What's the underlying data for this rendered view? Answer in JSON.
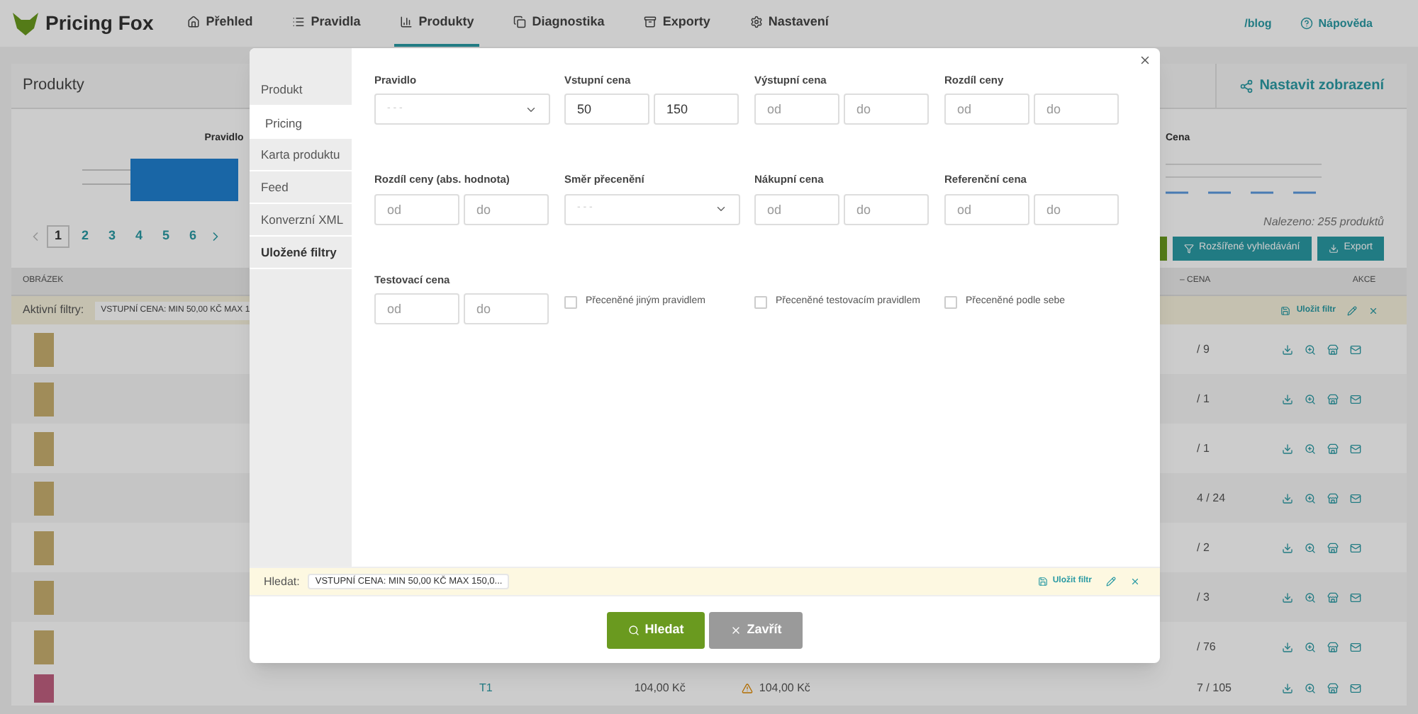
{
  "nav": {
    "brand": "Pricing Fox",
    "items": [
      {
        "label": "Přehled",
        "selected": false
      },
      {
        "label": "Pravidla",
        "selected": false
      },
      {
        "label": "Produkty",
        "selected": true
      },
      {
        "label": "Diagnostika",
        "selected": false
      },
      {
        "label": "Exporty",
        "selected": false
      },
      {
        "label": "Nastavení",
        "selected": false
      }
    ],
    "links": [
      "/blog",
      "Nápověda"
    ]
  },
  "page": {
    "title": "Produkty",
    "settings_button": "Nastavit zobrazení",
    "chart_left_title": "Pravidlo",
    "chart_right_title": "Cena",
    "pages": [
      {
        "label": "1",
        "selected": true
      },
      {
        "label": "2",
        "selected": false
      },
      {
        "label": "3",
        "selected": false
      },
      {
        "label": "4",
        "selected": false
      },
      {
        "label": "5",
        "selected": false
      },
      {
        "label": "6",
        "selected": false
      }
    ],
    "found": "Nalezeno: 255 produktů",
    "buttons": [
      "Rozšířené vyhledávání",
      "Export"
    ],
    "columns": [
      "OBRÁZEK",
      "– CENA",
      "AKCE"
    ],
    "active_filters": {
      "label": "Aktivní filtry:",
      "chip": "VSTUPNÍ CENA: MIN 50,00 KČ MAX 1",
      "save": "Uložit filtr"
    },
    "rows": [
      {
        "count": "/ 9"
      },
      {
        "count": "/ 1"
      },
      {
        "count": "/ 1"
      },
      {
        "count": "4 / 24"
      },
      {
        "count": "/ 2"
      },
      {
        "count": "/ 3"
      },
      {
        "count": "/ 76"
      }
    ],
    "last_row": {
      "rule": "T1",
      "price": "104,00 Kč",
      "new_price": "104,00 Kč",
      "count": "7 / 105"
    }
  },
  "modal": {
    "tabs": [
      {
        "label": "Produkt",
        "selected": false,
        "bold": false
      },
      {
        "label": "Pricing",
        "selected": true,
        "bold": false
      },
      {
        "label": "Karta produktu",
        "selected": false,
        "bold": false
      },
      {
        "label": "Feed",
        "selected": false,
        "bold": false
      },
      {
        "label": "Konverzní XML",
        "selected": false,
        "bold": false
      },
      {
        "label": "Uložené filtry",
        "selected": false,
        "bold": true
      }
    ],
    "fields": [
      {
        "kind": "select",
        "label": "Pravidlo",
        "placeholder": "- - -"
      },
      {
        "kind": "range",
        "label": "Vstupní cena",
        "from": {
          "value": "50"
        },
        "to": {
          "value": "150"
        }
      },
      {
        "kind": "range",
        "label": "Výstupní cena",
        "from": {
          "placeholder": "od"
        },
        "to": {
          "placeholder": "do"
        }
      },
      {
        "kind": "range",
        "label": "Rozdíl ceny",
        "from": {
          "placeholder": "od"
        },
        "to": {
          "placeholder": "do"
        }
      },
      {
        "kind": "range",
        "label": "Rozdíl ceny (abs. hodnota)",
        "from": {
          "placeholder": "od"
        },
        "to": {
          "placeholder": "do"
        }
      },
      {
        "kind": "select",
        "label": "Směr přecenění",
        "placeholder": "- - -"
      },
      {
        "kind": "range",
        "label": "Nákupní cena",
        "from": {
          "placeholder": "od"
        },
        "to": {
          "placeholder": "do"
        }
      },
      {
        "kind": "range",
        "label": "Referenční cena",
        "from": {
          "placeholder": "od"
        },
        "to": {
          "placeholder": "do"
        }
      },
      {
        "kind": "range",
        "label": "Testovací cena",
        "from": {
          "placeholder": "od"
        },
        "to": {
          "placeholder": "do"
        }
      },
      {
        "kind": "checkbox",
        "label": "Přeceněné jiným pravidlem",
        "checked": false
      },
      {
        "kind": "checkbox",
        "label": "Přeceněné testovacím pravidlem",
        "checked": false
      },
      {
        "kind": "checkbox",
        "label": "Přeceněné podle sebe",
        "checked": false
      }
    ],
    "search": {
      "label": "Hledat:",
      "value": "VSTUPNÍ CENA: MIN 50,00 KČ MAX 150,0...",
      "save": "Uložit filtr"
    },
    "buttons": [
      {
        "label": "Hledat",
        "kind": "primary"
      },
      {
        "label": "Zavřít",
        "kind": "secondary"
      }
    ]
  }
}
